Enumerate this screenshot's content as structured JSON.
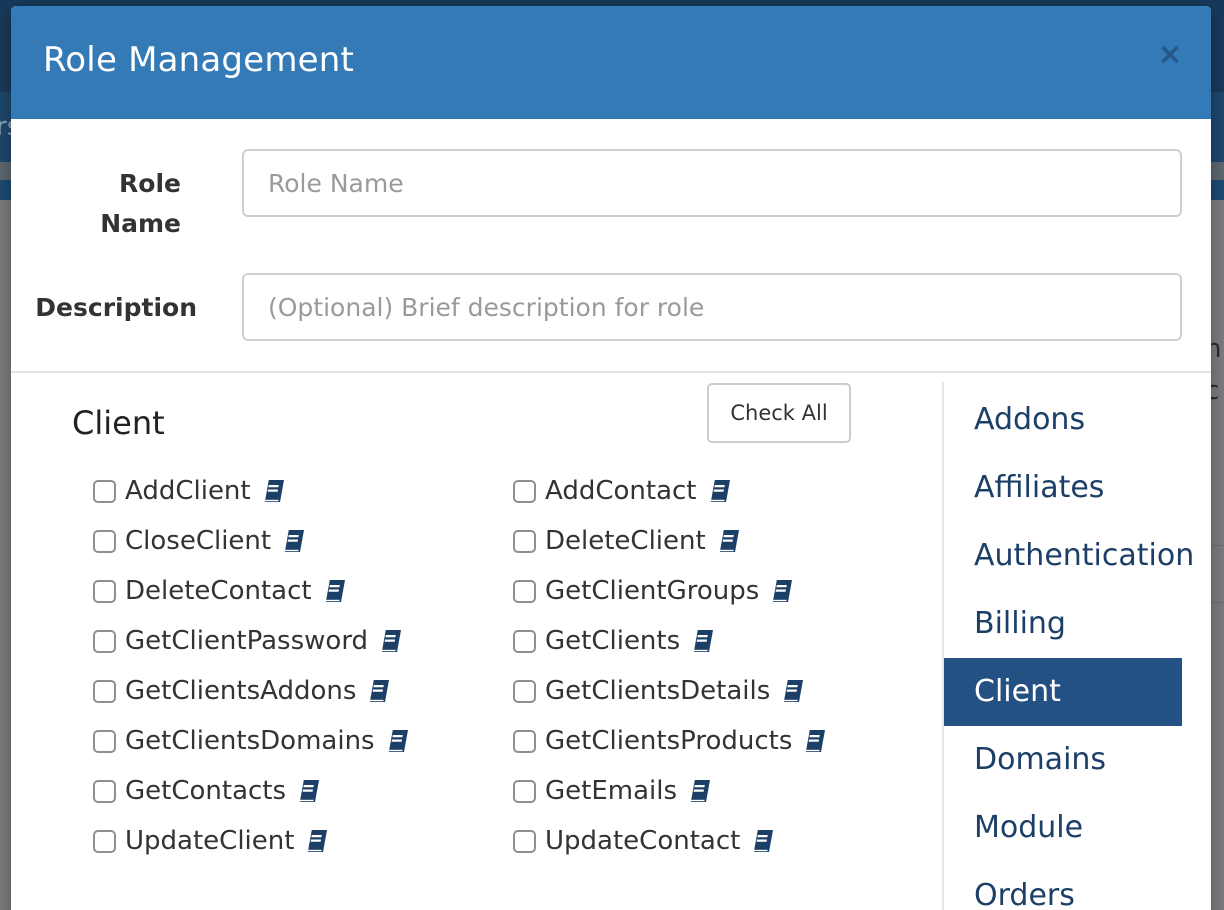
{
  "background": {
    "nav_fragment": "rs",
    "side_fragment_1": "h",
    "side_fragment_2": "c"
  },
  "modal": {
    "title": "Role Management",
    "close_symbol": "×"
  },
  "form": {
    "role_name_label": "Role Name",
    "role_name_placeholder": "Role Name",
    "role_name_value": "",
    "description_label": "Description",
    "description_placeholder": "(Optional) Brief description for role",
    "description_value": ""
  },
  "section": {
    "title": "Client",
    "check_all_label": "Check All"
  },
  "permissions": [
    {
      "label": "AddClient",
      "checked": false,
      "icon": "book-icon"
    },
    {
      "label": "AddContact",
      "checked": false,
      "icon": "book-icon"
    },
    {
      "label": "CloseClient",
      "checked": false,
      "icon": "book-icon"
    },
    {
      "label": "DeleteClient",
      "checked": false,
      "icon": "book-icon"
    },
    {
      "label": "DeleteContact",
      "checked": false,
      "icon": "book-icon"
    },
    {
      "label": "GetClientGroups",
      "checked": false,
      "icon": "book-icon"
    },
    {
      "label": "GetClientPassword",
      "checked": false,
      "icon": "book-icon"
    },
    {
      "label": "GetClients",
      "checked": false,
      "icon": "book-icon"
    },
    {
      "label": "GetClientsAddons",
      "checked": false,
      "icon": "book-icon"
    },
    {
      "label": "GetClientsDetails",
      "checked": false,
      "icon": "book-icon"
    },
    {
      "label": "GetClientsDomains",
      "checked": false,
      "icon": "book-icon"
    },
    {
      "label": "GetClientsProducts",
      "checked": false,
      "icon": "book-icon"
    },
    {
      "label": "GetContacts",
      "checked": false,
      "icon": "book-icon"
    },
    {
      "label": "GetEmails",
      "checked": false,
      "icon": "book-icon"
    },
    {
      "label": "UpdateClient",
      "checked": false,
      "icon": "book-icon"
    },
    {
      "label": "UpdateContact",
      "checked": false,
      "icon": "book-icon"
    }
  ],
  "sidebar": {
    "active": "Client",
    "items": [
      "Addons",
      "Affiliates",
      "Authentication",
      "Billing",
      "Client",
      "Domains",
      "Module",
      "Orders"
    ]
  },
  "colors": {
    "header": "#337ab7",
    "active_nav": "#235183",
    "nav_text": "#1c3f67",
    "doc_icon": "#1c3f67"
  }
}
